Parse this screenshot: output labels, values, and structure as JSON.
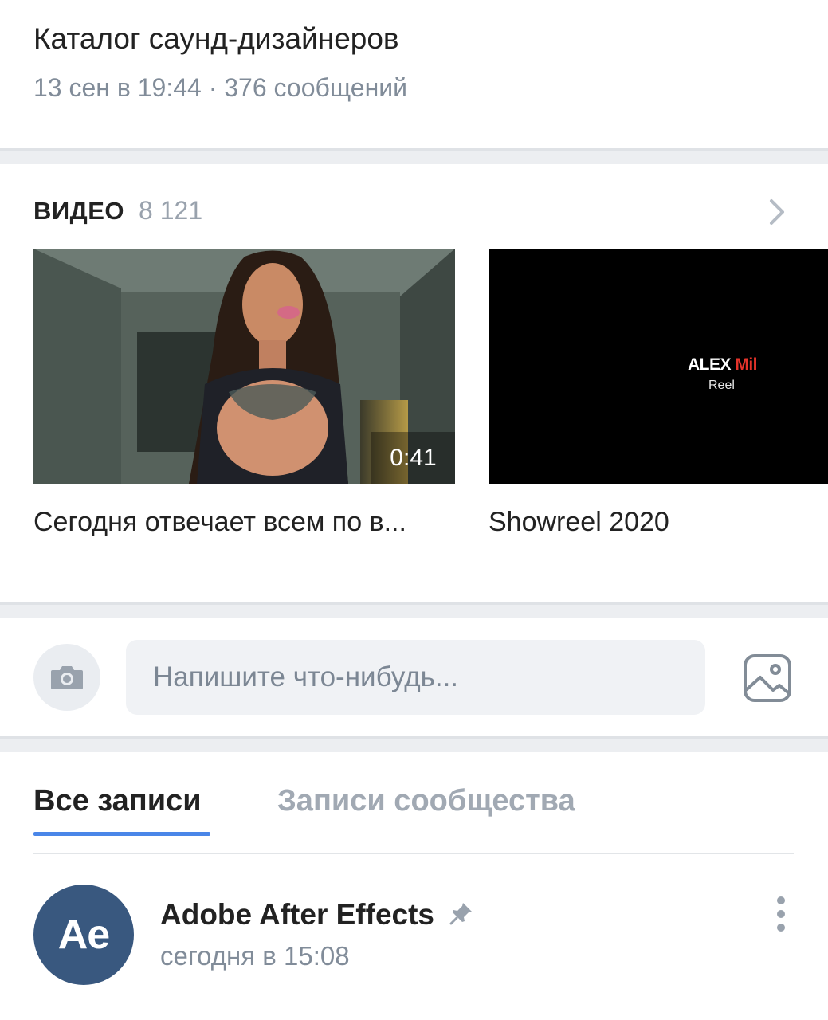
{
  "topic": {
    "title": "Каталог саунд-дизайнеров",
    "meta": "13 сен в 19:44 · 376 сообщений"
  },
  "videos": {
    "header": "ВИДЕО",
    "count": "8 121",
    "items": [
      {
        "caption": "Сегодня отвечает всем по в...",
        "duration": "0:41"
      },
      {
        "caption": "Showreel 2020",
        "thumb_title_a": "ALEX ",
        "thumb_title_b": "Mil",
        "thumb_subtitle": "Reel"
      }
    ]
  },
  "composer": {
    "placeholder": "Напишите что-нибудь..."
  },
  "wall": {
    "tabs": [
      "Все записи",
      "Записи сообщества"
    ],
    "active_tab": 0,
    "post": {
      "avatar_text": "Ae",
      "author": "Adobe After Effects",
      "time": "сегодня в 15:08"
    }
  },
  "colors": {
    "accent": "#4a86e8",
    "secondary_text": "#818c99",
    "separator": "#eceef1",
    "avatar_bg": "#39587f",
    "mil_red": "#e5332a"
  },
  "icons": [
    "chevron-right-icon",
    "camera-icon",
    "image-icon",
    "pin-icon",
    "more-vertical-icon"
  ]
}
